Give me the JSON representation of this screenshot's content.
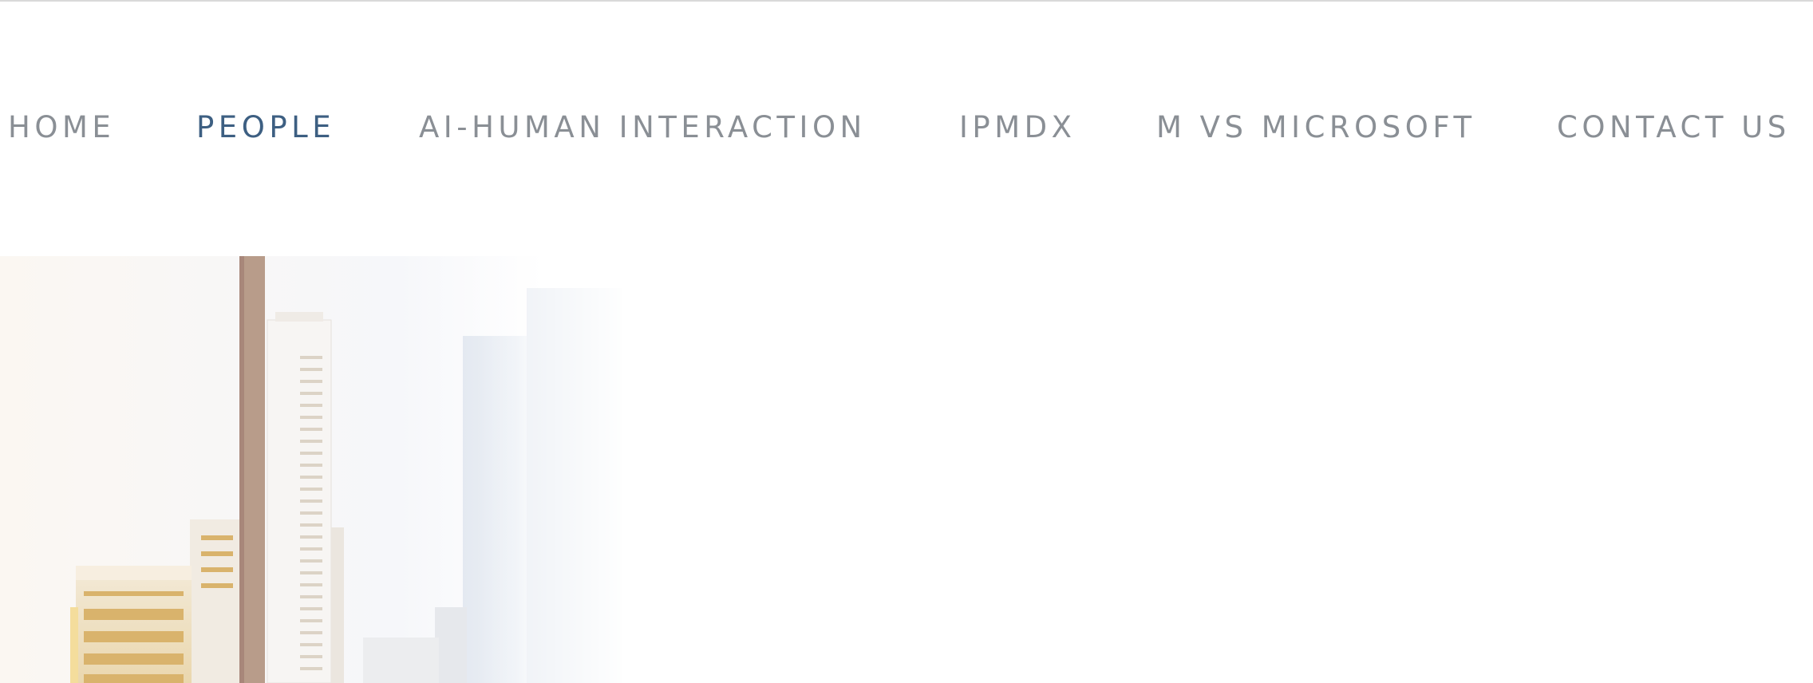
{
  "nav": {
    "items": [
      {
        "label": "HOME",
        "active": false
      },
      {
        "label": "PEOPLE",
        "active": true
      },
      {
        "label": "AI-HUMAN INTERACTION",
        "active": false
      },
      {
        "label": "IPMDX",
        "active": false
      },
      {
        "label": "M VS MICROSOFT",
        "active": false
      },
      {
        "label": "CONTACT US",
        "active": false
      }
    ]
  },
  "colors": {
    "nav_text": "#8a8f95",
    "nav_active": "#3d5f82",
    "background": "#ffffff"
  },
  "hero": {
    "image": "city-skyline-image"
  }
}
